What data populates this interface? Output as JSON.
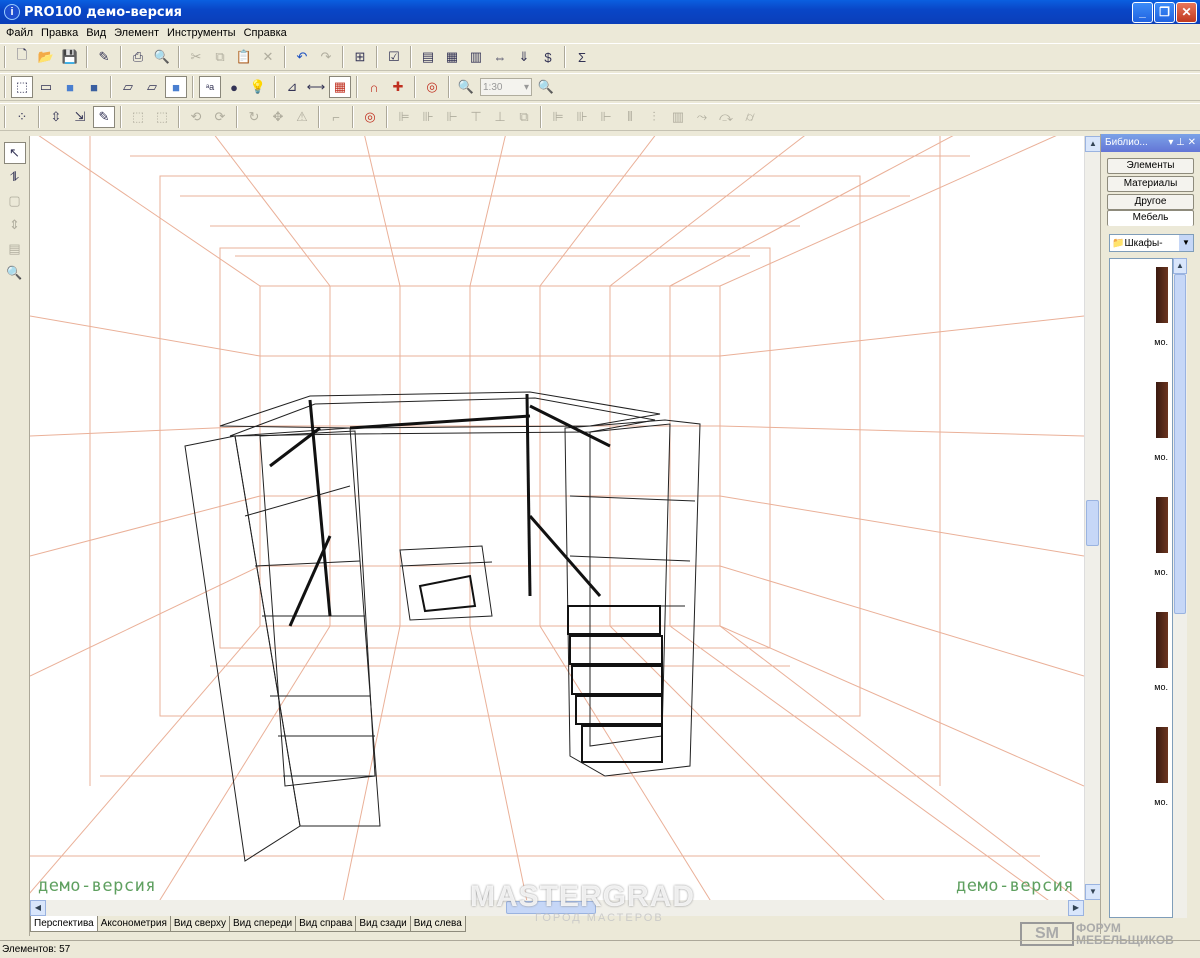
{
  "window": {
    "title": "PRO100 демо-версия"
  },
  "menu": [
    "Файл",
    "Правка",
    "Вид",
    "Элемент",
    "Инструменты",
    "Справка"
  ],
  "toolbar2": {
    "zoom": "1:30"
  },
  "viewport": {
    "watermark_left": "демо-версия",
    "watermark_right": "демо-версия"
  },
  "view_tabs": [
    "Перспектива",
    "Аксонометрия",
    "Вид сверху",
    "Вид спереди",
    "Вид справа",
    "Вид сзади",
    "Вид слева"
  ],
  "status": {
    "elements": "Элементов: 57"
  },
  "library": {
    "title": "Библио...",
    "tabs": [
      "Элементы",
      "Материалы",
      "Другое",
      "Мебель"
    ],
    "folder": "Шкафы-",
    "items": [
      "мо.",
      "мо.",
      "мо.",
      "мо.",
      "мо."
    ]
  },
  "overlay": {
    "mastergrad": "MASTERGRAD",
    "mastergrad_sub": "ГОРОД МАСТЕРОВ",
    "forum_logo": "SM",
    "forum_line1": "ФОРУМ",
    "forum_line2": "МЕБЕЛЬЩИКОВ"
  },
  "colors": {
    "grid": "#e8a080",
    "titlebar": "#0a5fe0"
  }
}
